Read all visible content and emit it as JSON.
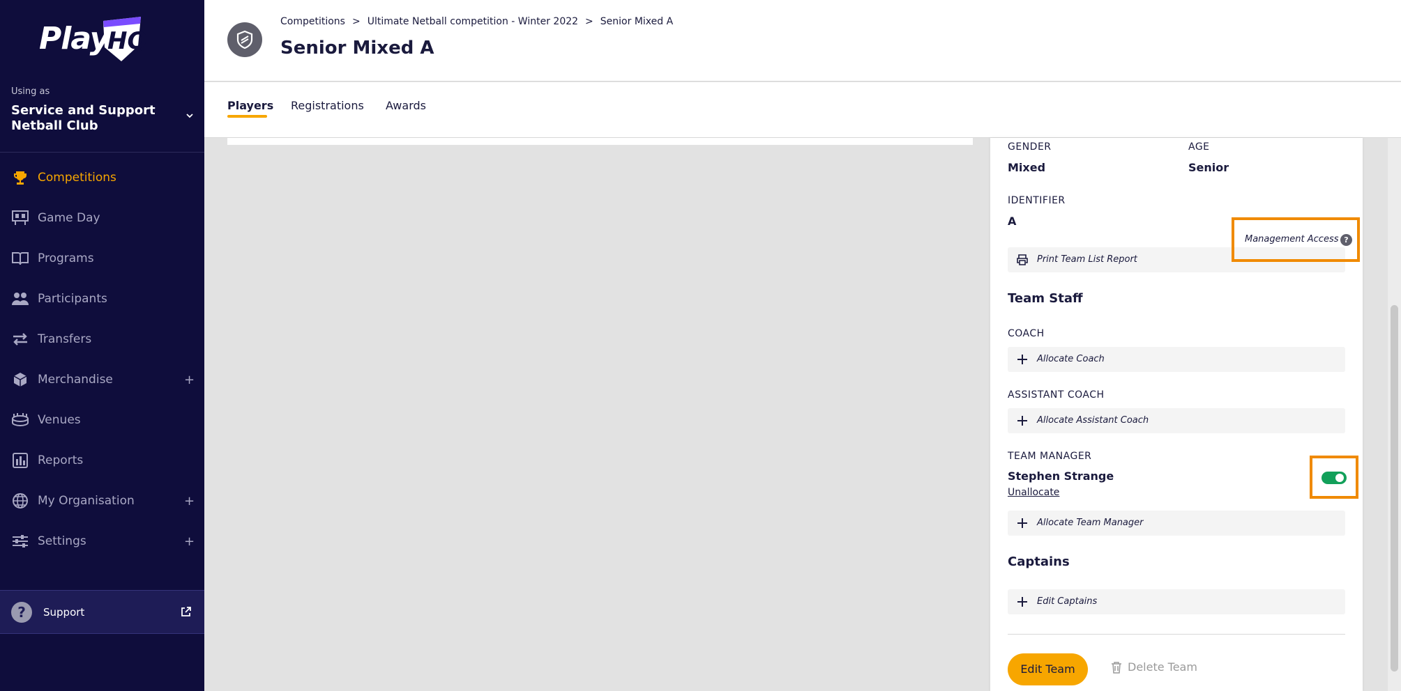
{
  "brand": {
    "logo_text": "Play",
    "logo_badge": "HQ"
  },
  "org": {
    "using_as": "Using as",
    "name": "Service and Support Netball Club"
  },
  "nav": [
    {
      "id": "competitions",
      "label": "Competitions",
      "icon": "trophy-icon",
      "active": true,
      "expandable": false
    },
    {
      "id": "game-day",
      "label": "Game Day",
      "icon": "scoreboard-icon",
      "active": false,
      "expandable": false
    },
    {
      "id": "programs",
      "label": "Programs",
      "icon": "book-icon",
      "active": false,
      "expandable": false
    },
    {
      "id": "participants",
      "label": "Participants",
      "icon": "people-icon",
      "active": false,
      "expandable": false
    },
    {
      "id": "transfers",
      "label": "Transfers",
      "icon": "transfer-arrows-icon",
      "active": false,
      "expandable": false
    },
    {
      "id": "merchandise",
      "label": "Merchandise",
      "icon": "box-icon",
      "active": false,
      "expandable": true
    },
    {
      "id": "venues",
      "label": "Venues",
      "icon": "stadium-icon",
      "active": false,
      "expandable": false
    },
    {
      "id": "reports",
      "label": "Reports",
      "icon": "bar-chart-icon",
      "active": false,
      "expandable": false
    },
    {
      "id": "my-organisation",
      "label": "My Organisation",
      "icon": "globe-icon",
      "active": false,
      "expandable": true
    },
    {
      "id": "settings",
      "label": "Settings",
      "icon": "sliders-icon",
      "active": false,
      "expandable": true
    }
  ],
  "nav_plus": "+",
  "support": {
    "label": "Support"
  },
  "breadcrumb": [
    "Competitions",
    "Ultimate Netball competition - Winter 2022",
    "Senior Mixed A"
  ],
  "breadcrumb_sep": ">",
  "page_title": "Senior Mixed A",
  "tabs": [
    "Players",
    "Registrations",
    "Awards"
  ],
  "team": {
    "gender_label": "GENDER",
    "gender": "Mixed",
    "age_label": "AGE",
    "age": "Senior",
    "identifier_label": "IDENTIFIER",
    "identifier": "A",
    "print_report": "Print Team List Report"
  },
  "staff": {
    "title": "Team Staff",
    "management_access": "Management Access",
    "help_glyph": "?",
    "coach_label": "COACH",
    "allocate_coach": "Allocate Coach",
    "assistant_label": "ASSISTANT COACH",
    "allocate_assistant": "Allocate Assistant Coach",
    "manager_label": "TEAM MANAGER",
    "manager_name": "Stephen Strange",
    "unallocate": "Unallocate",
    "allocate_manager": "Allocate Team Manager",
    "manager_access_on": true
  },
  "captains": {
    "title": "Captains",
    "edit": "Edit Captains"
  },
  "actions": {
    "edit_team": "Edit Team",
    "delete_team": "Delete Team"
  },
  "colors": {
    "sidebar": "#0f0d3c",
    "accent": "#f7a600",
    "highlight": "#f08a00",
    "toggle_on": "#12a05a"
  }
}
